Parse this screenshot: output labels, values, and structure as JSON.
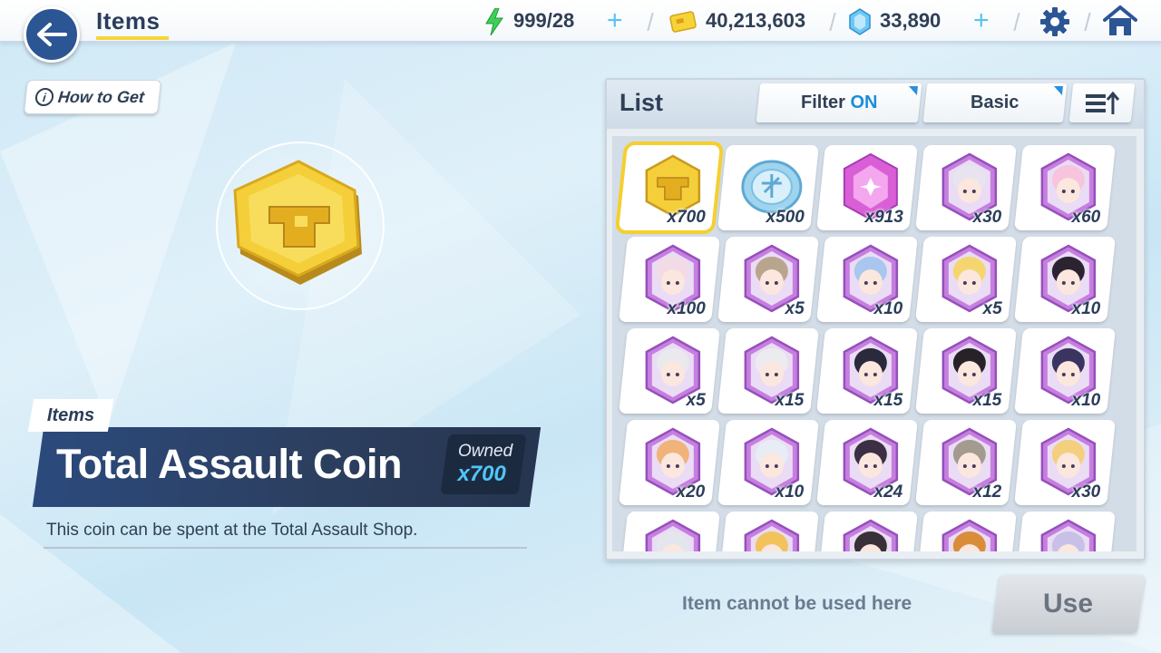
{
  "header": {
    "title": "Items",
    "ap": "999/28",
    "credits": "40,213,603",
    "pyroxene": "33,890"
  },
  "detail": {
    "how_to_get": "How to Get",
    "info_glyph": "i",
    "category": "Items",
    "name": "Total Assault Coin",
    "owned_label": "Owned",
    "owned_value": "x700",
    "description": "This coin can be spent at the Total Assault Shop."
  },
  "list": {
    "label": "List",
    "filter_label": "Filter",
    "filter_state": "ON",
    "sort_label": "Basic",
    "items": [
      {
        "icon": "total-assault-coin-icon",
        "qty": "x700",
        "kind": "coin",
        "selected": true
      },
      {
        "icon": "silver-medal-icon",
        "qty": "x500",
        "kind": "silver"
      },
      {
        "icon": "purple-crystal-icon",
        "qty": "x913",
        "kind": "crystal"
      },
      {
        "icon": "student-eleph-icon",
        "qty": "x30",
        "kind": "eleph",
        "hair": "#e8e4ef"
      },
      {
        "icon": "student-eleph-icon",
        "qty": "x60",
        "kind": "eleph",
        "hair": "#f6c4dc"
      },
      {
        "icon": "student-eleph-icon",
        "qty": "x100",
        "kind": "eleph",
        "hair": "#f2dbe4"
      },
      {
        "icon": "student-eleph-icon",
        "qty": "x5",
        "kind": "eleph",
        "hair": "#b9a48e"
      },
      {
        "icon": "student-eleph-icon",
        "qty": "x10",
        "kind": "eleph",
        "hair": "#a8c6ee"
      },
      {
        "icon": "student-eleph-icon",
        "qty": "x5",
        "kind": "eleph",
        "hair": "#f5d570"
      },
      {
        "icon": "student-eleph-icon",
        "qty": "x10",
        "kind": "eleph",
        "hair": "#2b2330"
      },
      {
        "icon": "student-eleph-icon",
        "qty": "x5",
        "kind": "eleph",
        "hair": "#e9e9ee"
      },
      {
        "icon": "student-eleph-icon",
        "qty": "x15",
        "kind": "eleph",
        "hair": "#ecebef"
      },
      {
        "icon": "student-eleph-icon",
        "qty": "x15",
        "kind": "eleph",
        "hair": "#2a2a3c"
      },
      {
        "icon": "student-eleph-icon",
        "qty": "x15",
        "kind": "eleph",
        "hair": "#262228"
      },
      {
        "icon": "student-eleph-icon",
        "qty": "x10",
        "kind": "eleph",
        "hair": "#3a3460"
      },
      {
        "icon": "student-eleph-icon",
        "qty": "x20",
        "kind": "eleph",
        "hair": "#f0b37a"
      },
      {
        "icon": "student-eleph-icon",
        "qty": "x10",
        "kind": "eleph",
        "hair": "#e8ecf4"
      },
      {
        "icon": "student-eleph-icon",
        "qty": "x24",
        "kind": "eleph",
        "hair": "#3c2f44"
      },
      {
        "icon": "student-eleph-icon",
        "qty": "x12",
        "kind": "eleph",
        "hair": "#a39a90"
      },
      {
        "icon": "student-eleph-icon",
        "qty": "x30",
        "kind": "eleph",
        "hair": "#f3cf7e"
      },
      {
        "icon": "student-eleph-icon",
        "qty": "",
        "kind": "eleph",
        "hair": "#e4e6ee"
      },
      {
        "icon": "student-eleph-icon",
        "qty": "",
        "kind": "eleph",
        "hair": "#f2c35c"
      },
      {
        "icon": "student-eleph-icon",
        "qty": "",
        "kind": "eleph",
        "hair": "#3a3038"
      },
      {
        "icon": "student-eleph-icon",
        "qty": "",
        "kind": "eleph",
        "hair": "#d98d3a"
      },
      {
        "icon": "student-eleph-icon",
        "qty": "",
        "kind": "eleph",
        "hair": "#c8c0e6"
      }
    ]
  },
  "footer": {
    "use_message": "Item cannot be used here",
    "use_button": "Use"
  },
  "colors": {
    "accent_blue": "#2c5594",
    "highlight_yellow": "#f5cf2e",
    "filter_on": "#1a8ed8"
  }
}
